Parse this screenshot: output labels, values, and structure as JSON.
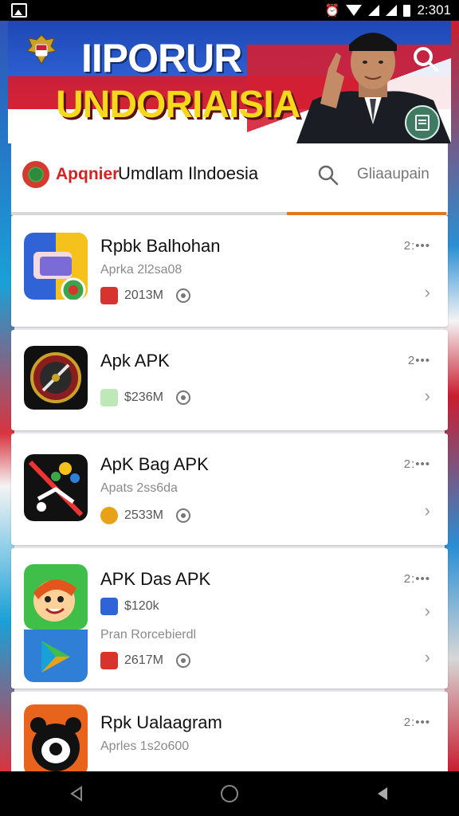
{
  "status_bar": {
    "time": "2:301",
    "icons": [
      "image-icon",
      "alarm-icon",
      "wifi-icon",
      "signal-icon",
      "signal-icon",
      "battery-icon"
    ]
  },
  "banner": {
    "title_line1": "IIPORUR",
    "title_line2": "UNDORIAISIA",
    "colors": {
      "blue": "#2c5fd0",
      "red": "#d52234",
      "yellow": "#f6d91a"
    }
  },
  "header": {
    "brand": "Apqnier",
    "title": "Umdlam Ilndoesia",
    "search_label": "Gliaaupain",
    "accent": "#e2781c"
  },
  "apps": [
    {
      "name": "Rpbk Balhohan",
      "subtitle": "Aprka 2l2sa08",
      "size": "2013M",
      "timestamp": "2:•••",
      "icon": "photo-app-icon"
    },
    {
      "name": "Apk APK",
      "subtitle": "",
      "size": "$236M",
      "timestamp": "2•••",
      "icon": "compass-app-icon"
    },
    {
      "name": "ApK Bag APK",
      "subtitle": "Apats 2ss6da",
      "size": "2533M",
      "timestamp": "2:•••",
      "icon": "scissors-app-icon"
    },
    {
      "name": "APK Das APK",
      "subtitle": "",
      "size": "$120k",
      "extra_subtitle": "Pran Rorcebierdl",
      "extra_size": "2617M",
      "timestamp": "2:•••",
      "icon": "cartoon-face-app-icon",
      "icon2": "play-store-app-icon"
    },
    {
      "name": "Rpk Ualaagram",
      "subtitle": "Aprles 1s2o600",
      "size": "",
      "timestamp": "2:•••",
      "icon": "panda-app-icon"
    }
  ],
  "nav": {
    "buttons": [
      "back-icon",
      "home-icon",
      "recents-icon"
    ]
  }
}
